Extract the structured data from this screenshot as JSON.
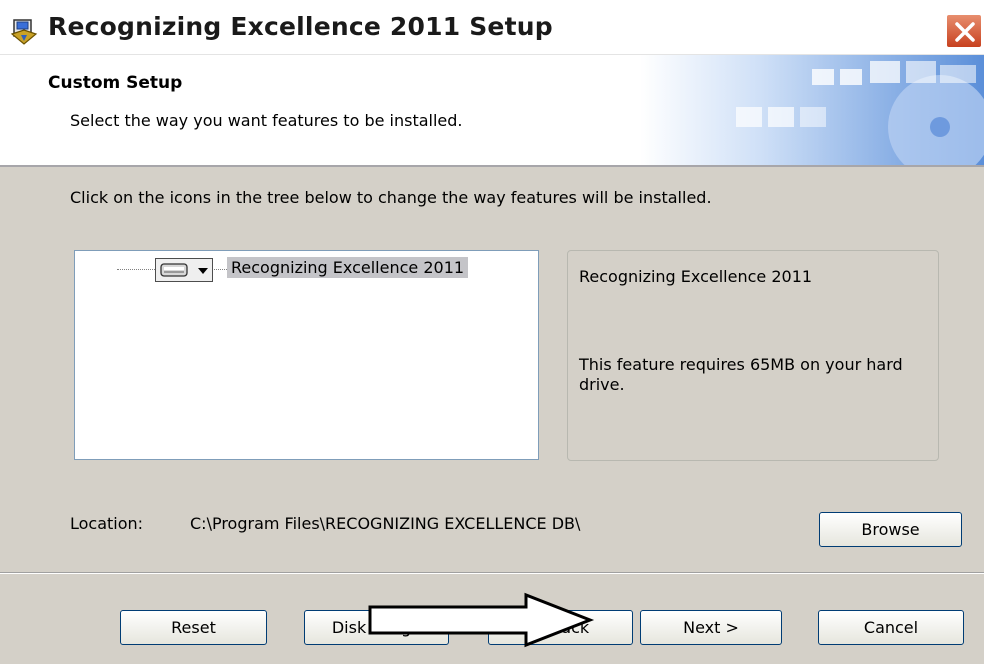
{
  "window": {
    "title": "Recognizing Excellence 2011 Setup",
    "close_icon": "close-icon"
  },
  "banner": {
    "heading": "Custom Setup",
    "subheading": "Select the way you want features to be installed."
  },
  "instructions": "Click on the icons in the tree below to change the way features will be installed.",
  "tree": {
    "feature_label": "Recognizing Excellence 2011",
    "feature_icon": "drive-icon",
    "dropdown_icon": "dropdown-arrow-icon"
  },
  "description": {
    "name": "Recognizing Excellence 2011",
    "requirement": "This feature requires 65MB on your hard drive."
  },
  "location": {
    "label": "Location:",
    "path": "C:\\Program Files\\RECOGNIZING EXCELLENCE DB\\"
  },
  "buttons": {
    "browse": "Browse",
    "reset": "Reset",
    "disk_usage": "Disk Usage",
    "back": "< Back",
    "next": "Next >",
    "cancel": "Cancel"
  },
  "colors": {
    "dialog_bg": "#d4d0c8",
    "button_border": "#003c74",
    "close_button": "#c8411f",
    "selection_bg": "#c4c4c8"
  }
}
